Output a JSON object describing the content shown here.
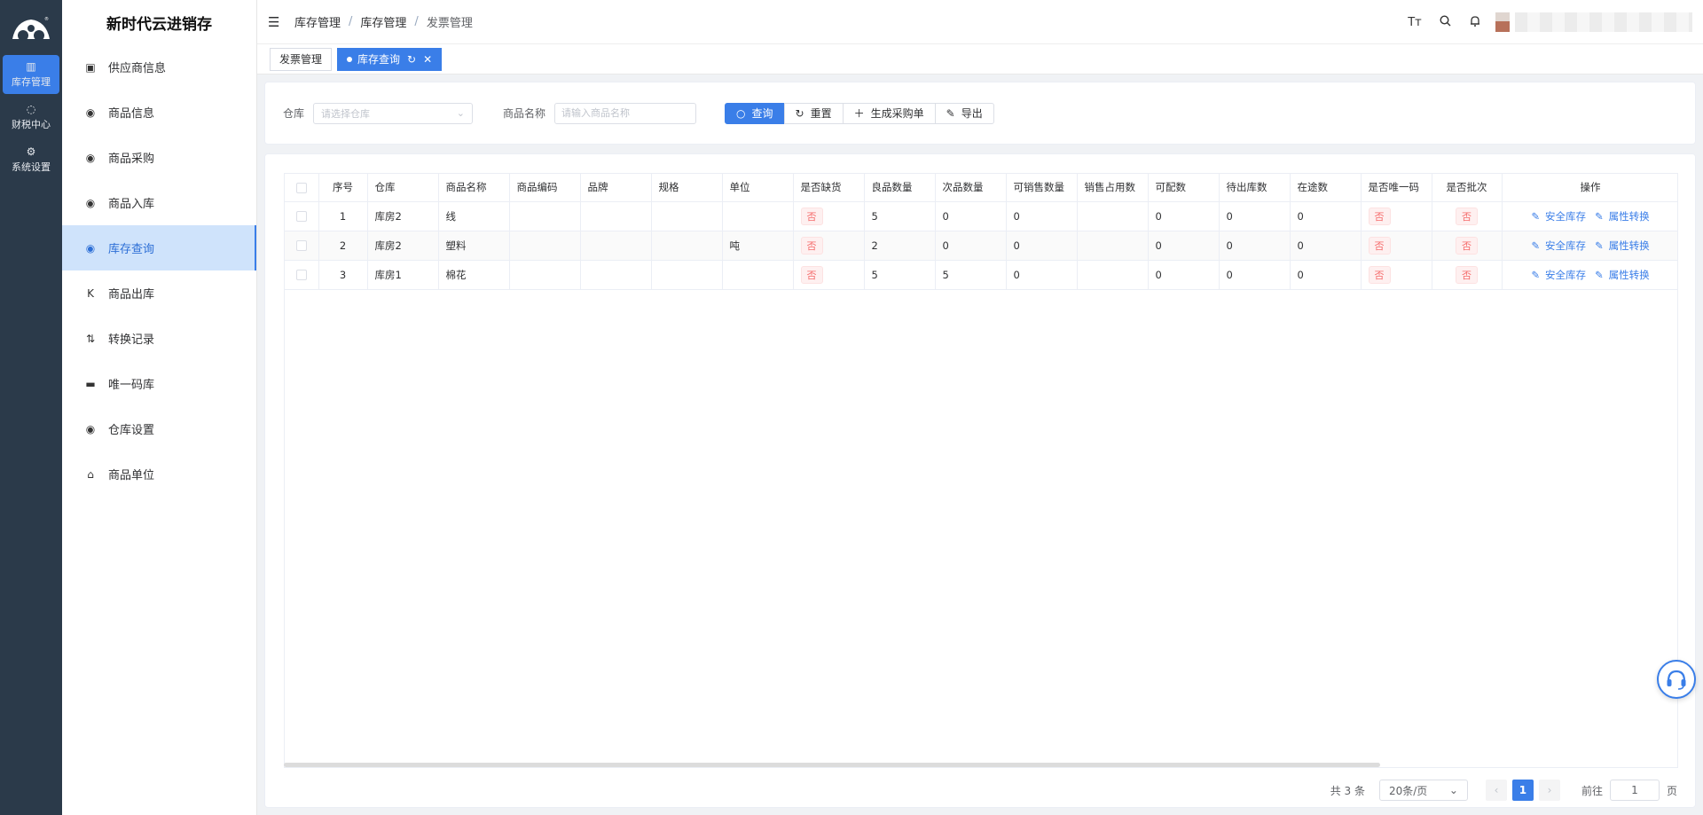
{
  "rail": {
    "items": [
      {
        "label": "库存管理",
        "icon": "grid-icon",
        "glyph": "▥",
        "active": true
      },
      {
        "label": "财税中心",
        "icon": "apple-icon",
        "glyph": "◌",
        "active": false
      },
      {
        "label": "系统设置",
        "icon": "gear-icon",
        "glyph": "⚙",
        "active": false
      }
    ]
  },
  "menu": {
    "brand": "新时代云进销存",
    "items": [
      {
        "label": "供应商信息",
        "icon": "id-card-icon",
        "glyph": "▣"
      },
      {
        "label": "商品信息",
        "icon": "chrome-icon",
        "glyph": "◉"
      },
      {
        "label": "商品采购",
        "icon": "chrome-icon",
        "glyph": "◉"
      },
      {
        "label": "商品入库",
        "icon": "chrome-icon",
        "glyph": "◉"
      },
      {
        "label": "库存查询",
        "icon": "chrome-icon",
        "glyph": "◉"
      },
      {
        "label": "商品出库",
        "icon": "k-icon",
        "glyph": "K"
      },
      {
        "label": "转换记录",
        "icon": "swap-icon",
        "glyph": "⇅"
      },
      {
        "label": "唯一码库",
        "icon": "monitor-icon",
        "glyph": "▬"
      },
      {
        "label": "仓库设置",
        "icon": "chrome-icon",
        "glyph": "◉"
      },
      {
        "label": "商品单位",
        "icon": "house-icon",
        "glyph": "⌂"
      }
    ]
  },
  "header": {
    "breadcrumb": [
      "库存管理",
      "库存管理",
      "发票管理"
    ],
    "icons": {
      "font_size": "Tт",
      "search": "⌕",
      "bell": "🔔"
    }
  },
  "tags": [
    {
      "label": "发票管理",
      "active": false
    },
    {
      "label": "库存查询",
      "active": true
    }
  ],
  "search": {
    "warehouse_label": "仓库",
    "warehouse_placeholder": "请选择仓库",
    "name_label": "商品名称",
    "name_placeholder": "请输入商品名称",
    "buttons": {
      "query": "查询",
      "reset": "重置",
      "gen_po": "生成采购单",
      "export": "导出"
    }
  },
  "table": {
    "columns": [
      "序号",
      "仓库",
      "商品名称",
      "商品编码",
      "品牌",
      "规格",
      "单位",
      "是否缺货",
      "良品数量",
      "次品数量",
      "可销售数量",
      "销售占用数",
      "可配数",
      "待出库数",
      "在途数",
      "是否唯一码",
      "是否批次",
      "操作"
    ],
    "rows": [
      {
        "no": "1",
        "warehouse": "库房2",
        "name": "线",
        "code": "",
        "brand": "",
        "spec": "",
        "unit": "",
        "shortage": "否",
        "good": "5",
        "defect": "0",
        "sellable": "0",
        "occupied": "",
        "allocatable": "0",
        "pending_out": "0",
        "in_transit": "0",
        "unique": "否",
        "batch": "否"
      },
      {
        "no": "2",
        "warehouse": "库房2",
        "name": "塑料",
        "code": "",
        "brand": "",
        "spec": "",
        "unit": "吨",
        "shortage": "否",
        "good": "2",
        "defect": "0",
        "sellable": "0",
        "occupied": "",
        "allocatable": "0",
        "pending_out": "0",
        "in_transit": "0",
        "unique": "否",
        "batch": "否"
      },
      {
        "no": "3",
        "warehouse": "库房1",
        "name": "棉花",
        "code": "",
        "brand": "",
        "spec": "",
        "unit": "",
        "shortage": "否",
        "good": "5",
        "defect": "5",
        "sellable": "0",
        "occupied": "",
        "allocatable": "0",
        "pending_out": "0",
        "in_transit": "0",
        "unique": "否",
        "batch": "否"
      }
    ],
    "actions": {
      "safety_stock": "安全库存",
      "attr_convert": "属性转换"
    }
  },
  "pager": {
    "total": "共 3 条",
    "page_size": "20条/页",
    "current_page": "1",
    "goto_label": "前往",
    "goto_value": "1",
    "page_suffix": "页"
  },
  "colors": {
    "accent": "#3a7ee8",
    "rail": "#2b3a4a",
    "danger": "#f56c6c"
  }
}
